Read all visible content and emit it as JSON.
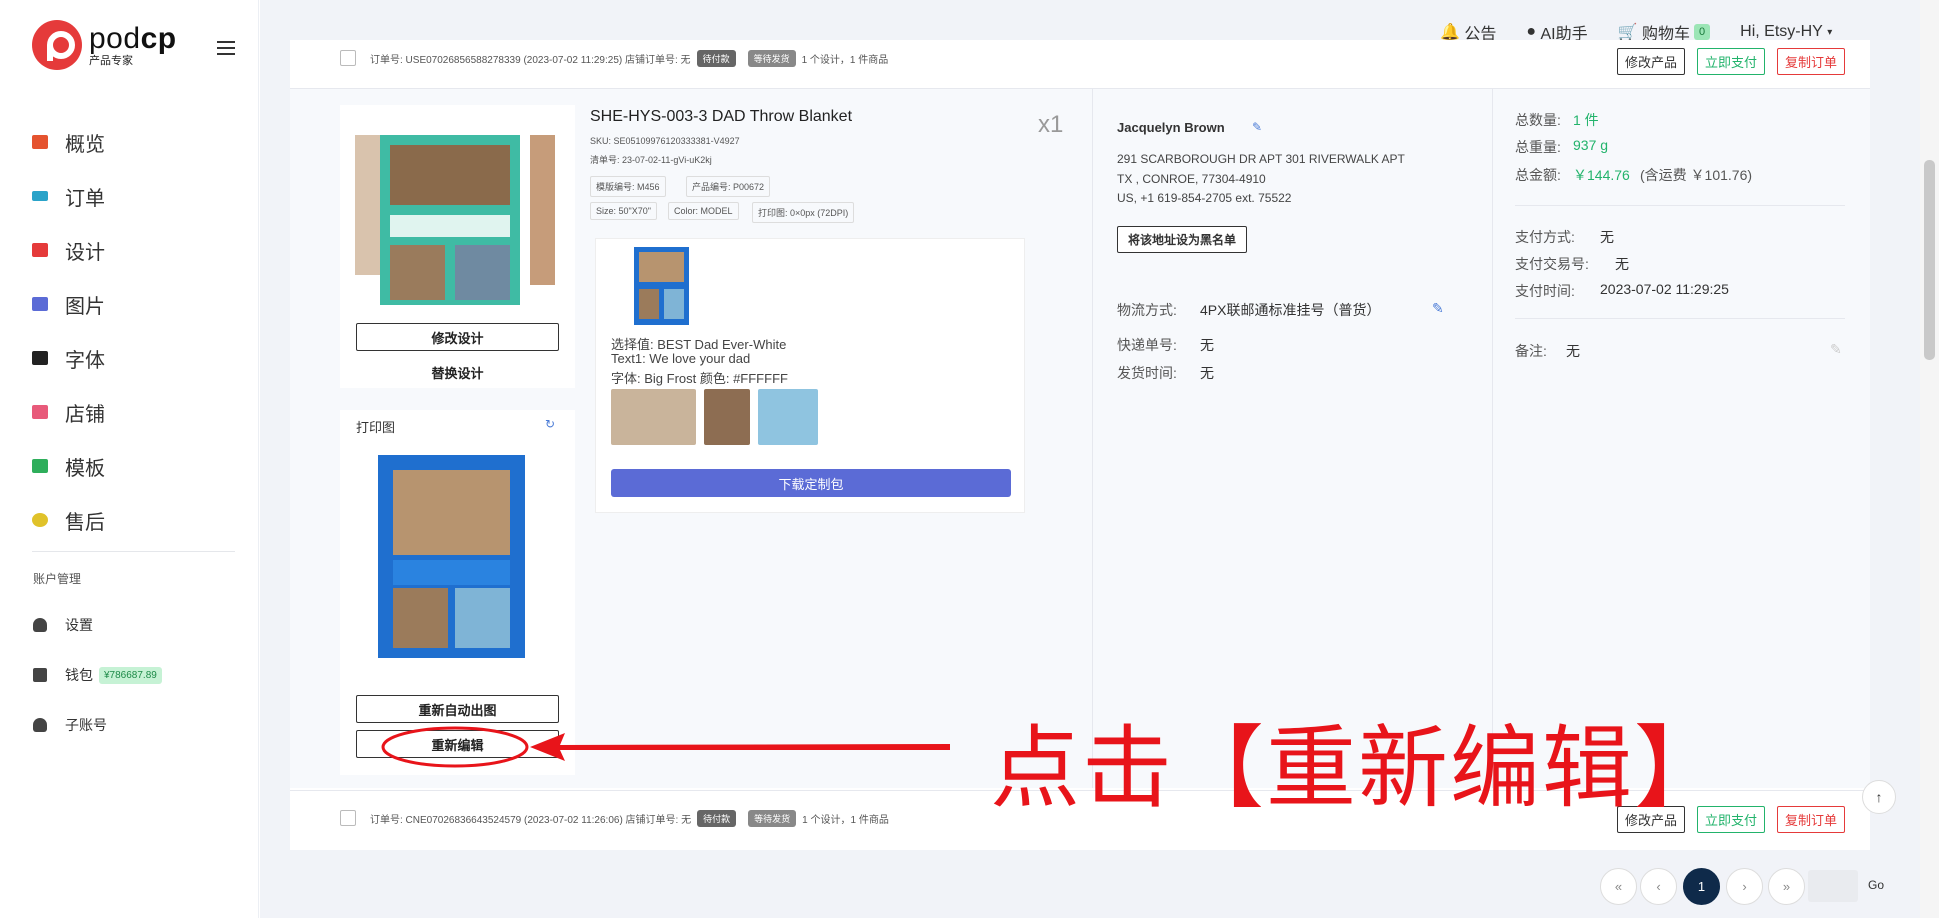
{
  "brand": {
    "name_plain": "pod",
    "name_bold": "cp",
    "subtitle": "产品专家"
  },
  "nav": [
    {
      "label": "概览",
      "color": "#e5532f"
    },
    {
      "label": "订单",
      "color": "#2aa3c9"
    },
    {
      "label": "设计",
      "color": "#e53a3a"
    },
    {
      "label": "图片",
      "color": "#5b6bd6"
    },
    {
      "label": "字体",
      "color": "#222222"
    },
    {
      "label": "店铺",
      "color": "#e85a7a"
    },
    {
      "label": "模板",
      "color": "#2eae5b"
    },
    {
      "label": "售后",
      "color": "#e0c22a"
    }
  ],
  "account": {
    "title": "账户管理",
    "items": [
      {
        "label": "设置"
      },
      {
        "label": "钱包",
        "badge": "¥786687.89"
      },
      {
        "label": "子账号"
      }
    ]
  },
  "topbar": {
    "notice": "公告",
    "ai": "AI助手",
    "cart": "购物车",
    "cart_count": "0",
    "user": "Hi, Etsy-HY"
  },
  "order1": {
    "header": "订单号: USE07026856588278339  (2023-07-02 11:29:25)   店铺订单号: 无",
    "pill1": "待付款",
    "pill2": "等待发货",
    "summary": "1 个设计，1 件商品",
    "actions": {
      "edit": "修改产品",
      "pay": "立即支付",
      "copy": "复制订单"
    },
    "buttons": {
      "modify_design": "修改设计",
      "replace_design": "替换设计",
      "print_label": "打印图",
      "reauto": "重新自动出图",
      "reedit": "重新编辑"
    },
    "product": {
      "title": "SHE-HYS-003-3 DAD Throw Blanket",
      "qty": "x1",
      "sku": "SKU: SE05109976120333381-V4927",
      "list_no": "清单号: 23-07-02-11-gVi-uK2kj",
      "tags": [
        "模版编号: M456",
        "产品编号: P00672",
        "Size: 50\"X70\"",
        "Color: MODEL",
        "打印图: 0×0px (72DPI)"
      ],
      "options": [
        "选择值: BEST Dad Ever-White",
        "Text1:   We love your dad",
        "字体: Big Frost   颜色: #FFFFFF"
      ],
      "download": "下载定制包"
    },
    "customer": {
      "name": "Jacquelyn Brown",
      "addr1": "291 SCARBOROUGH DR APT 301 RIVERWALK APT",
      "addr2": "TX , CONROE, 77304-4910",
      "addr3": "US, +1 619-854-2705 ext. 75522",
      "blacklist": "将该地址设为黑名单",
      "shipping_label": "物流方式:",
      "shipping": "4PX联邮通标准挂号（普货）",
      "tracking_label": "快递单号:",
      "tracking": "无",
      "ship_time_label": "发货时间:",
      "ship_time": "无"
    },
    "totals": {
      "qty_label": "总数量:",
      "qty": "1 件",
      "weight_label": "总重量:",
      "weight": "937 g",
      "amount_label": "总金额:",
      "amount": "￥144.76",
      "shipping_note": "(含运费 ￥101.76)",
      "pay_method_label": "支付方式:",
      "pay_method": "无",
      "pay_no_label": "支付交易号:",
      "pay_no": "无",
      "pay_time_label": "支付时间:",
      "pay_time": "2023-07-02 11:29:25",
      "remark_label": "备注:",
      "remark": "无"
    }
  },
  "order2": {
    "header": "订单号: CNE07026836643524579  (2023-07-02 11:26:06)   店铺订单号: 无",
    "pill1": "待付款",
    "pill2": "等待发货",
    "summary": "1 个设计，1 件商品",
    "actions": {
      "edit": "修改产品",
      "pay": "立即支付",
      "copy": "复制订单"
    }
  },
  "annotation": {
    "text": "点击【重新编辑】"
  },
  "pagination": {
    "current": "1",
    "go": "Go"
  }
}
